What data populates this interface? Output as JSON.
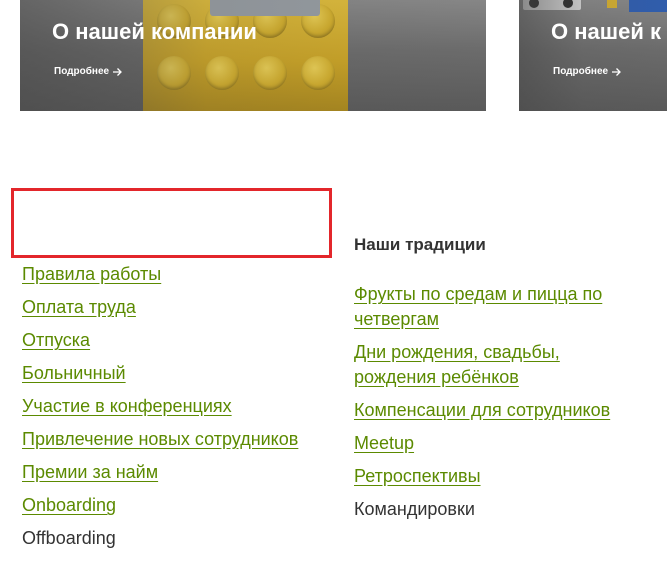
{
  "cards": [
    {
      "title": "О нашей компании",
      "more_label": "Подробнее"
    },
    {
      "title": "О нашей к",
      "more_label": "Подробнее"
    }
  ],
  "left_column": {
    "links": [
      {
        "label": "Правила работы",
        "linked": true
      },
      {
        "label": "Оплата труда",
        "linked": true
      },
      {
        "label": "Отпуска",
        "linked": true
      },
      {
        "label": "Больничный",
        "linked": true
      },
      {
        "label": "Участие в конференциях",
        "linked": true
      },
      {
        "label": "Привлечение новых сотрудников",
        "linked": true
      },
      {
        "label": "Премии за найм",
        "linked": true
      },
      {
        "label": "Onboarding",
        "linked": true
      },
      {
        "label": "Offboarding",
        "linked": false
      }
    ]
  },
  "right_column": {
    "heading": "Наши традиции",
    "links": [
      {
        "label": "Фрукты по средам и пицца по четвергам",
        "linked": true
      },
      {
        "label": "Дни рождения, свадьбы, рождения ребёнков",
        "linked": true
      },
      {
        "label": "Компенсации для сотрудников",
        "linked": true
      },
      {
        "label": "Meetup",
        "linked": true
      },
      {
        "label": "Ретроспективы",
        "linked": true
      },
      {
        "label": "Командировки",
        "linked": false
      }
    ]
  },
  "colors": {
    "link": "#5b8a00",
    "text": "#333333",
    "highlight": "#e3262b"
  },
  "icons": {
    "more": "arrow-right-icon"
  }
}
